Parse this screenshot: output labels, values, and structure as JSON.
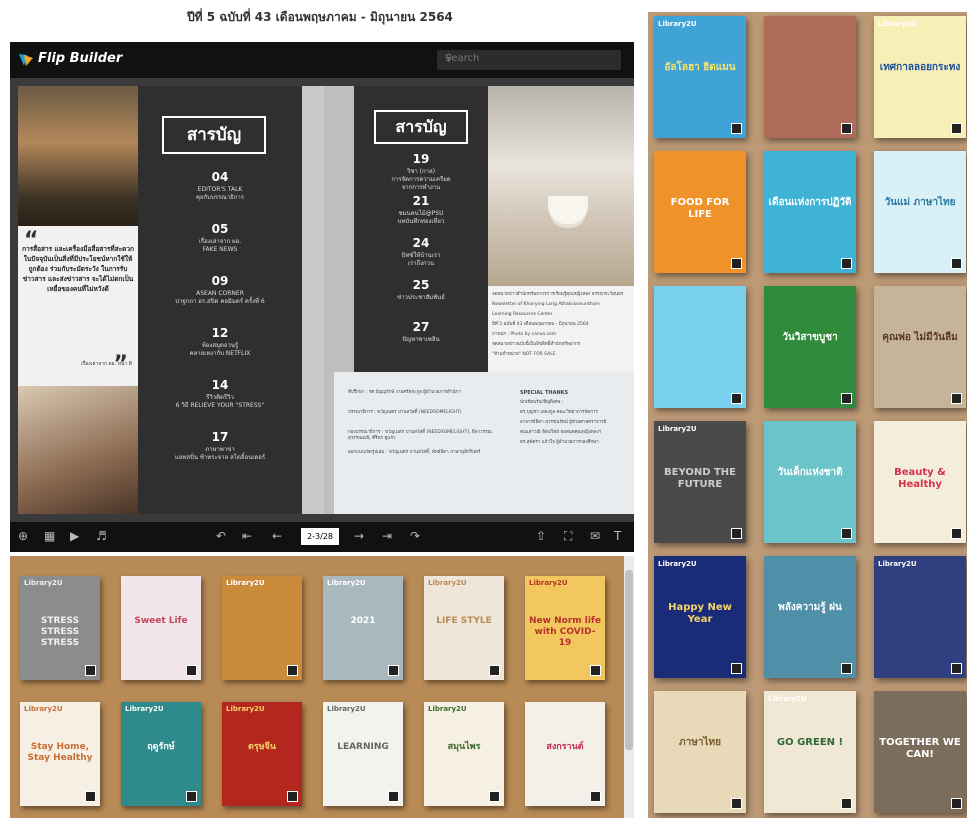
{
  "heading": "ปีที่ 5 ฉบับที่ 43 เดือนพฤษภาคม - มิถุนายน 2564",
  "viewer": {
    "brand": "Flip Builder",
    "search_placeholder": "Search",
    "page_counter": "2-3/28",
    "toolbar_icons": [
      "zoom-in-icon",
      "thumbnails-icon",
      "play-icon",
      "sound-icon",
      "back-icon",
      "first-page-icon",
      "prev-page-icon",
      "next-page-icon",
      "last-page-icon",
      "share-icon",
      "fullscreen-icon",
      "email-icon",
      "text-icon"
    ]
  },
  "left_page": {
    "title": "สารบัญ",
    "quote": "การสื่อสาร และเครื่องมือสื่อสารที่สะดวกในปัจจุบันเป็นสิ่งที่มีประโยชน์หากใช้ให้ถูกต้อง ร่วมกับระมัดระวัง ในการรับข่าวสาร และส่งข่าวสาร จะได้ไม่ตกเป็นเหยื่อของคนที่ไม่หวังดี",
    "quote_source": "เรื่องเล่าจาก ผอ. หน้า 8",
    "items": [
      {
        "num": "04",
        "lines": [
          "EDITOR'S TALK",
          "คุยกับบรรณาธิการ"
        ]
      },
      {
        "num": "05",
        "lines": [
          "เรื่องเล่าจาก ผอ.",
          "FAKE NEWS"
        ]
      },
      {
        "num": "09",
        "lines": [
          "ASEAN CORNER",
          "ปาฐกถา อร.สปิด คอมิมตร์ ครั้งที่ 6"
        ]
      },
      {
        "num": "12",
        "lines": [
          "ห้องสมุดอวนรู้",
          "คลายเหงากับ NETFLIX"
        ]
      },
      {
        "num": "14",
        "lines": [
          "รีวิวติดรีวิว",
          "6 วิธี RELIEVE YOUR \"STRESS\""
        ]
      },
      {
        "num": "17",
        "lines": [
          "ภาษาพาข่า",
          "แอทสปั่น ซ้าทระจาล สโตลิ้อนเดอร์"
        ]
      }
    ]
  },
  "right_page": {
    "title": "สารบัญ",
    "items": [
      {
        "num": "19",
        "lines": [
          "วิชา (กาล)",
          "การจัดการความเครียด",
          "จากการทำงาน"
        ]
      },
      {
        "num": "21",
        "lines": [
          "ชมนคนไม้@PSU",
          "บทบันทึกท่องเที่ยว"
        ]
      },
      {
        "num": "24",
        "lines": [
          "บิทซ์ให้บ้านเรา",
          "เราถึงกวน"
        ]
      },
      {
        "num": "25",
        "lines": [
          "ข่าวประชาสัมพันธ์"
        ]
      },
      {
        "num": "27",
        "lines": [
          "ปัญหาพาเพลิน"
        ]
      }
    ],
    "credits": [
      "จดหมายข่าวสำนักทรัพยากรการเรียนรู้คุณหญิงหลง อรรถกระวีสุนทร",
      "Newsletter of Khunying Long Athakravisunthorn",
      "Learning Resources Center",
      "ปีที่ 5 ฉบับที่ 43 เดือนพฤษภาคม - มิถุนายน 2564",
      "ภาพปก : Photo by canva.com",
      "จดหมายข่าวฉบับนี้เป็นลิขสิทธิ์สำนักทรัพยากร",
      "\"ห้ามจำหน่าย\" NOT FOR SALE"
    ],
    "staff_left": [
      "ที่ปรึกษา :  รศ.ปัญญรักษ์ งามศรีตระกูล ผู้อำนวยการสำนักฯ",
      "บรรณาธิการ :  ขวัญเนตร ปานสวัสดิ์ (NEEDSOMELIGHT)",
      "กองบรรณาธิการ :  ขวัญเนตร ปานสวัสดิ์ (NEEDSOMELIGHT), พิลาวรรณ สุวรรณมณี, ศิริพร ชูแก้ว",
      "ออกแบบ/จัดรูปเล่ม :  ขวัญเนตร ปานสวัสดิ์, พัทธ์ธิดา ภาษามุสิกรินทร์"
    ],
    "staff_right_title": "SPECIAL THANKS",
    "staff_right": [
      "นักเขียนรับเชิญพิเศษ :",
      "ดร.บุญชา เสลงกูล คณะวิทยาการจัดการ",
      "อาจารย์ธิดา สุวรรณรัตน์ ผู้ช่วยศาสตราจารย์",
      "คุณเสาวณี จิตนวิทย์ หอสมุดคุณหญิงหลงฯ",
      "ดร.สุพัตรา แก้วใจ ผู้อำนวยการกองศึกษา"
    ]
  },
  "shelf_books": [
    {
      "brand": "Library2U",
      "title": "STRESS STRESS STRESS",
      "bg": "#8b8c8e",
      "fg": "#f0f0f0"
    },
    {
      "brand": "",
      "title": "Sweet Life",
      "bg": "#f3e6ea",
      "fg": "#c2455c"
    },
    {
      "brand": "Library2U",
      "title": "",
      "bg": "#c98a3a",
      "fg": "#fff"
    },
    {
      "brand": "Library2U",
      "title": "2021",
      "bg": "#a9b7bf",
      "fg": "#fff"
    },
    {
      "brand": "Library2U",
      "title": "LIFE STYLE",
      "bg": "#efe6da",
      "fg": "#b88a54"
    },
    {
      "brand": "Library2U",
      "title": "New Norm life with COVID-19",
      "bg": "#f2c75e",
      "fg": "#b6322a"
    },
    {
      "brand": "Library2U",
      "title": "Stay Home, Stay Healthy",
      "bg": "#f6efe4",
      "fg": "#c76f35"
    },
    {
      "brand": "Library2U",
      "title": "ฤดูรักษ์",
      "bg": "#2f8a8c",
      "fg": "#fff"
    },
    {
      "brand": "Library2U",
      "title": "ตรุษจีน",
      "bg": "#b4271e",
      "fg": "#f6d36a"
    },
    {
      "brand": "Library2U",
      "title": "LEARNING",
      "bg": "#f2f2ee",
      "fg": "#666"
    },
    {
      "brand": "Library2U",
      "title": "สมุนไพร",
      "bg": "#f6f0e4",
      "fg": "#3d6b2c"
    },
    {
      "brand": "",
      "title": "สงกรานต์",
      "bg": "#f3efe9",
      "fg": "#c0314e"
    }
  ],
  "grid_books": [
    {
      "brand": "Library2U",
      "title": "อัลโลฮา ฮิดแมน",
      "bg": "#3fa3d5",
      "fg": "#fce36a"
    },
    {
      "brand": "",
      "title": "",
      "bg": "#b06c5a",
      "fg": "#fff"
    },
    {
      "brand": "Library2U",
      "title": "เทศกาลลอยกระทง",
      "bg": "#f6f0b8",
      "fg": "#1d4f9a"
    },
    {
      "brand": "",
      "title": "FOOD FOR LIFE",
      "bg": "#f0922a",
      "fg": "#fff"
    },
    {
      "brand": "",
      "title": "เดือนแห่งการปฏิวัติ",
      "bg": "#3fb3d6",
      "fg": "#fff"
    },
    {
      "brand": "",
      "title": "วันแม่ ภาษาไทย",
      "bg": "#d8f0f6",
      "fg": "#2b7aa5"
    },
    {
      "brand": "",
      "title": "",
      "bg": "#7ad0ef",
      "fg": "#fff"
    },
    {
      "brand": "",
      "title": "วันวิสาขบูชา",
      "bg": "#2f8a3c",
      "fg": "#fff"
    },
    {
      "brand": "",
      "title": "คุณพ่อ ไม่มีวันลืม",
      "bg": "#c6b49a",
      "fg": "#5a3a25"
    },
    {
      "brand": "Library2U",
      "title": "BEYOND THE FUTURE",
      "bg": "#4a4a4a",
      "fg": "#ccc"
    },
    {
      "brand": "",
      "title": "วันเด็กแห่งชาติ",
      "bg": "#6ac4c9",
      "fg": "#fff"
    },
    {
      "brand": "",
      "title": "Beauty & Healthy",
      "bg": "#f4eddb",
      "fg": "#d4324a"
    },
    {
      "brand": "Library2U",
      "title": "Happy New Year",
      "bg": "#1a2b78",
      "fg": "#f6d36a"
    },
    {
      "brand": "",
      "title": "พลังความรู้ ฝน",
      "bg": "#4f8fa8",
      "fg": "#fff"
    },
    {
      "brand": "Library2U",
      "title": "",
      "bg": "#2f3f7f",
      "fg": "#fff"
    },
    {
      "brand": "",
      "title": "ภาษาไทย",
      "bg": "#e8d9b8",
      "fg": "#7a5a2c"
    },
    {
      "brand": "Library2U",
      "title": "GO GREEN !",
      "bg": "#f0e7d4",
      "fg": "#2d6a3a"
    },
    {
      "brand": "",
      "title": "TOGETHER WE CAN!",
      "bg": "#7c6c5c",
      "fg": "#fff"
    }
  ]
}
